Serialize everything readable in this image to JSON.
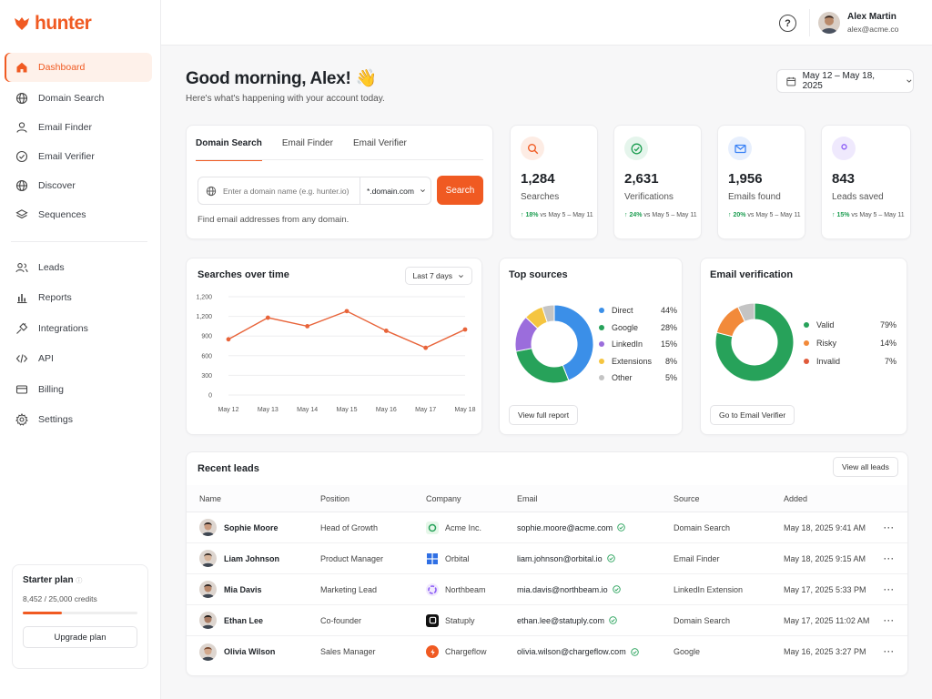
{
  "app": {
    "logo_text": "hunter"
  },
  "sidebar": {
    "items": [
      {
        "label": "Dashboard",
        "icon": "home-icon"
      },
      {
        "label": "Domain Search",
        "icon": "globe-icon"
      },
      {
        "label": "Email Finder",
        "icon": "user-icon"
      },
      {
        "label": "Email Verifier",
        "icon": "check-circle-icon"
      },
      {
        "label": "Discover",
        "icon": "globe-icon"
      },
      {
        "label": "Sequences",
        "icon": "layers-icon"
      },
      {
        "label": "Leads",
        "icon": "users-icon"
      },
      {
        "label": "Reports",
        "icon": "bar-chart-icon"
      },
      {
        "label": "Integrations",
        "icon": "plug-icon"
      },
      {
        "label": "API",
        "icon": "code-icon"
      },
      {
        "label": "Billing",
        "icon": "card-icon"
      },
      {
        "label": "Settings",
        "icon": "gear-icon"
      }
    ],
    "plan": {
      "title": "Starter plan",
      "credits": "8,452 / 25,000 credits",
      "used_fraction": 0.34,
      "upgrade_label": "Upgrade plan"
    }
  },
  "topbar": {
    "user_name": "Alex Martin",
    "user_email": "alex@acme.co"
  },
  "greeting": {
    "title": "Good morning, Alex! 👋",
    "subtitle": "Here's what's happening with your account today.",
    "date_range": "May 12 – May 18, 2025"
  },
  "search_card": {
    "tabs": [
      "Domain Search",
      "Email Finder",
      "Email Verifier"
    ],
    "input_placeholder": "Enter a domain name (e.g. hunter.io)",
    "domain_select": "*.domain.com",
    "search_label": "Search",
    "hint": "Find email addresses from any domain."
  },
  "stats": [
    {
      "value": "1,284",
      "label": "Searches",
      "delta": "18%",
      "compare": "vs May 5 – May 11",
      "icon": "search-icon",
      "color": "#f05a22",
      "bg": "#fdece4"
    },
    {
      "value": "2,631",
      "label": "Verifications",
      "delta": "24%",
      "compare": "vs May 5 – May 11",
      "icon": "check-circle-icon",
      "color": "#1e9e52",
      "bg": "#e5f5ec"
    },
    {
      "value": "1,956",
      "label": "Emails found",
      "delta": "20%",
      "compare": "vs May 5 – May 11",
      "icon": "mail-icon",
      "color": "#3b82f6",
      "bg": "#e7effd"
    },
    {
      "value": "843",
      "label": "Leads saved",
      "delta": "15%",
      "compare": "vs May 5 – May 11",
      "icon": "user-icon",
      "color": "#8b5cf6",
      "bg": "#efe9fd"
    }
  ],
  "searches_chart": {
    "title": "Searches over time",
    "period": "Last 7 days"
  },
  "top_sources": {
    "title": "Top sources",
    "button": "View full report"
  },
  "email_verification": {
    "title": "Email verification",
    "button": "Go to Email Verifier"
  },
  "chart_data": [
    {
      "type": "line",
      "title": "Searches over time",
      "categories": [
        "May 12",
        "May 13",
        "May 14",
        "May 15",
        "May 16",
        "May 17",
        "May 18"
      ],
      "values": [
        850,
        1180,
        1050,
        1280,
        980,
        720,
        1000
      ],
      "yticks": [
        "0",
        "300",
        "600",
        "900",
        "1,200",
        "1,200"
      ],
      "ylim": [
        0,
        1500
      ],
      "color": "#e8643a",
      "grid": true
    },
    {
      "type": "pie",
      "title": "Top sources",
      "labels": [
        "Direct",
        "Google",
        "LinkedIn",
        "Extensions",
        "Other"
      ],
      "values": [
        44,
        28,
        15,
        8,
        5
      ],
      "display": [
        "44%",
        "28%",
        "15%",
        "8%",
        "5%"
      ],
      "colors": [
        "#3b8fe8",
        "#27a25a",
        "#9b6ddc",
        "#f5c540",
        "#c4c4c4"
      ],
      "legend": "right"
    },
    {
      "type": "pie",
      "title": "Email verification",
      "labels": [
        "Valid",
        "Risky",
        "Invalid"
      ],
      "values": [
        79,
        14,
        7
      ],
      "display": [
        "79%",
        "14%",
        "7%"
      ],
      "colors": [
        "#27a25a",
        "#f28a3a",
        "#c4c4c4"
      ],
      "legend_colors": [
        "#27a25a",
        "#f28a3a",
        "#e05a3a"
      ],
      "legend": "right"
    }
  ],
  "leads": {
    "title": "Recent leads",
    "view_all": "View all leads",
    "columns": [
      "Name",
      "Position",
      "Company",
      "Email",
      "Source",
      "Added"
    ],
    "rows": [
      {
        "name": "Sophie Moore",
        "position": "Head of Growth",
        "company": "Acme Inc.",
        "email": "sophie.moore@acme.com",
        "source": "Domain Search",
        "added": "May 18, 2025 9:41 AM"
      },
      {
        "name": "Liam Johnson",
        "position": "Product Manager",
        "company": "Orbital",
        "email": "liam.johnson@orbital.io",
        "source": "Email Finder",
        "added": "May 18, 2025 9:15 AM"
      },
      {
        "name": "Mia Davis",
        "position": "Marketing Lead",
        "company": "Northbeam",
        "email": "mia.davis@northbeam.io",
        "source": "LinkedIn Extension",
        "added": "May 17, 2025 5:33 PM"
      },
      {
        "name": "Ethan Lee",
        "position": "Co-founder",
        "company": "Statuply",
        "email": "ethan.lee@statuply.com",
        "source": "Domain Search",
        "added": "May 17, 2025 11:02 AM"
      },
      {
        "name": "Olivia Wilson",
        "position": "Sales Manager",
        "company": "Chargeflow",
        "email": "olivia.wilson@chargeflow.com",
        "source": "Google",
        "added": "May 16, 2025 3:27 PM"
      }
    ],
    "more_label": "···"
  }
}
